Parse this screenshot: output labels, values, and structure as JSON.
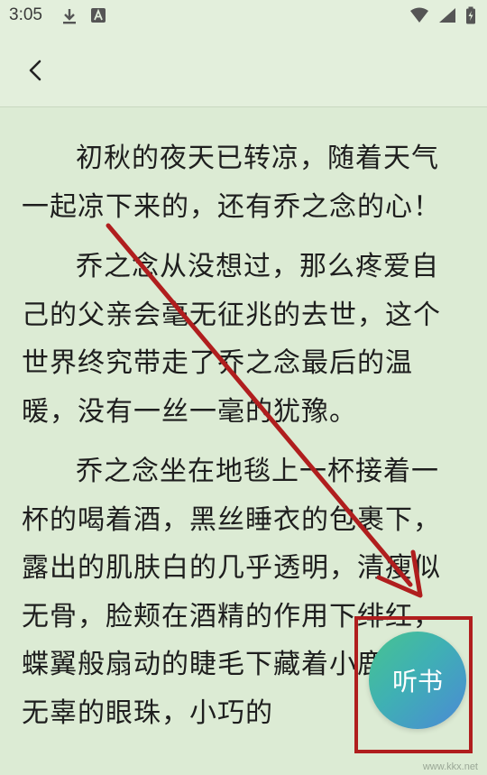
{
  "status_bar": {
    "time": "3:05",
    "icons_left": [
      "download-icon",
      "app-notification-icon"
    ],
    "icons_right": [
      "wifi-icon",
      "cellular-signal-icon",
      "battery-charging-icon"
    ]
  },
  "toolbar": {
    "back_icon": "back-chevron-icon"
  },
  "reader": {
    "paragraphs": [
      "初秋的夜天已转凉，随着天气一起凉下来的，还有乔之念的心！",
      "乔之念从没想过，那么疼爱自己的父亲会毫无征兆的去世，这个世界终究带走了乔之念最后的温暖，没有一丝一毫的犹豫。",
      "乔之念坐在地毯上一杯接着一杯的喝着酒，黑丝睡衣的包裹下，露出的肌肤白的几乎透明，清瘦似无骨，脸颊在酒精的作用下绯红，蝶翼般扇动的睫毛下藏着小鹿一样无辜的眼珠，小巧的"
    ]
  },
  "listen_button": {
    "label": "听书"
  },
  "colors": {
    "background": "#dcebd4",
    "annotation_red": "#b01e1e"
  },
  "watermark": {
    "text": "www.kkx.net"
  }
}
